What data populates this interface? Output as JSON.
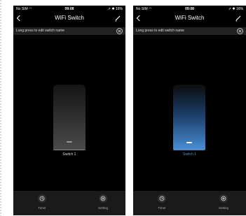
{
  "screens": [
    {
      "status": {
        "carrier": "No SIM",
        "time": "09:08",
        "battery": "16%"
      },
      "title": "WiFi Switch",
      "hint": "Long press to edit switch name",
      "switch": {
        "label": "Switch 1",
        "state": "off"
      },
      "tabs": {
        "timer": "Timer",
        "setting": "Setting"
      },
      "colors": {
        "background": "#000000",
        "accent": "#4a8fd6"
      },
      "icons": [
        "back-icon",
        "edit-icon",
        "close-icon",
        "clock-icon",
        "gear-icon"
      ]
    },
    {
      "status": {
        "carrier": "No SIM",
        "time": "09:08",
        "battery": "16%"
      },
      "title": "WiFi Switch",
      "hint": "Long press to edit switch name",
      "switch": {
        "label": "Switch 1",
        "state": "on"
      },
      "tabs": {
        "timer": "Timer",
        "setting": "Setting"
      },
      "colors": {
        "background": "#000000",
        "accent": "#4a8fd6"
      },
      "icons": [
        "back-icon",
        "edit-icon",
        "close-icon",
        "clock-icon",
        "gear-icon"
      ]
    }
  ]
}
